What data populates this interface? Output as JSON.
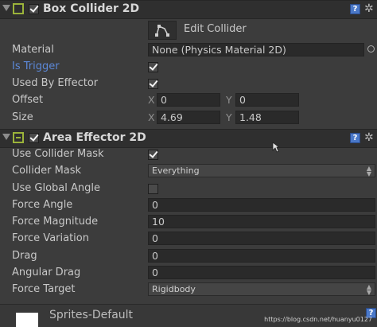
{
  "box_collider": {
    "title": "Box Collider 2D",
    "edit_collider_label": "Edit Collider",
    "rows": {
      "material_label": "Material",
      "material_value": "None (Physics Material 2D)",
      "is_trigger_label": "Is Trigger",
      "used_by_effector_label": "Used By Effector",
      "offset_label": "Offset",
      "offset_x_axis": "X",
      "offset_x": "0",
      "offset_y_axis": "Y",
      "offset_y": "0",
      "size_label": "Size",
      "size_x_axis": "X",
      "size_x": "4.69",
      "size_y_axis": "Y",
      "size_y": "1.48"
    },
    "is_trigger_checked": true,
    "used_by_effector_checked": true
  },
  "area_effector": {
    "title": "Area Effector 2D",
    "rows": {
      "use_collider_mask_label": "Use Collider Mask",
      "collider_mask_label": "Collider Mask",
      "collider_mask_value": "Everything",
      "use_global_angle_label": "Use Global Angle",
      "force_angle_label": "Force Angle",
      "force_angle_value": "0",
      "force_magnitude_label": "Force Magnitude",
      "force_magnitude_value": "10",
      "force_variation_label": "Force Variation",
      "force_variation_value": "0",
      "drag_label": "Drag",
      "drag_value": "0",
      "angular_drag_label": "Angular Drag",
      "angular_drag_value": "0",
      "force_target_label": "Force Target",
      "force_target_value": "Rigidbody"
    },
    "use_collider_mask_checked": true,
    "use_global_angle_checked": false
  },
  "bottom": {
    "sorting_layer": "Sprites-Default"
  },
  "watermark": "https://blog.csdn.net/huanyu0127",
  "icons": {
    "foldout": "triangle-down-icon",
    "help": "help-book-icon",
    "gear": "gear-icon",
    "edit_collider": "edit-collider-icon",
    "object_picker": "circle-target-icon"
  },
  "colors": {
    "label_highlight": "#5c88d8",
    "component_icon": "#9bb33a",
    "help_icon": "#4a78c8"
  }
}
